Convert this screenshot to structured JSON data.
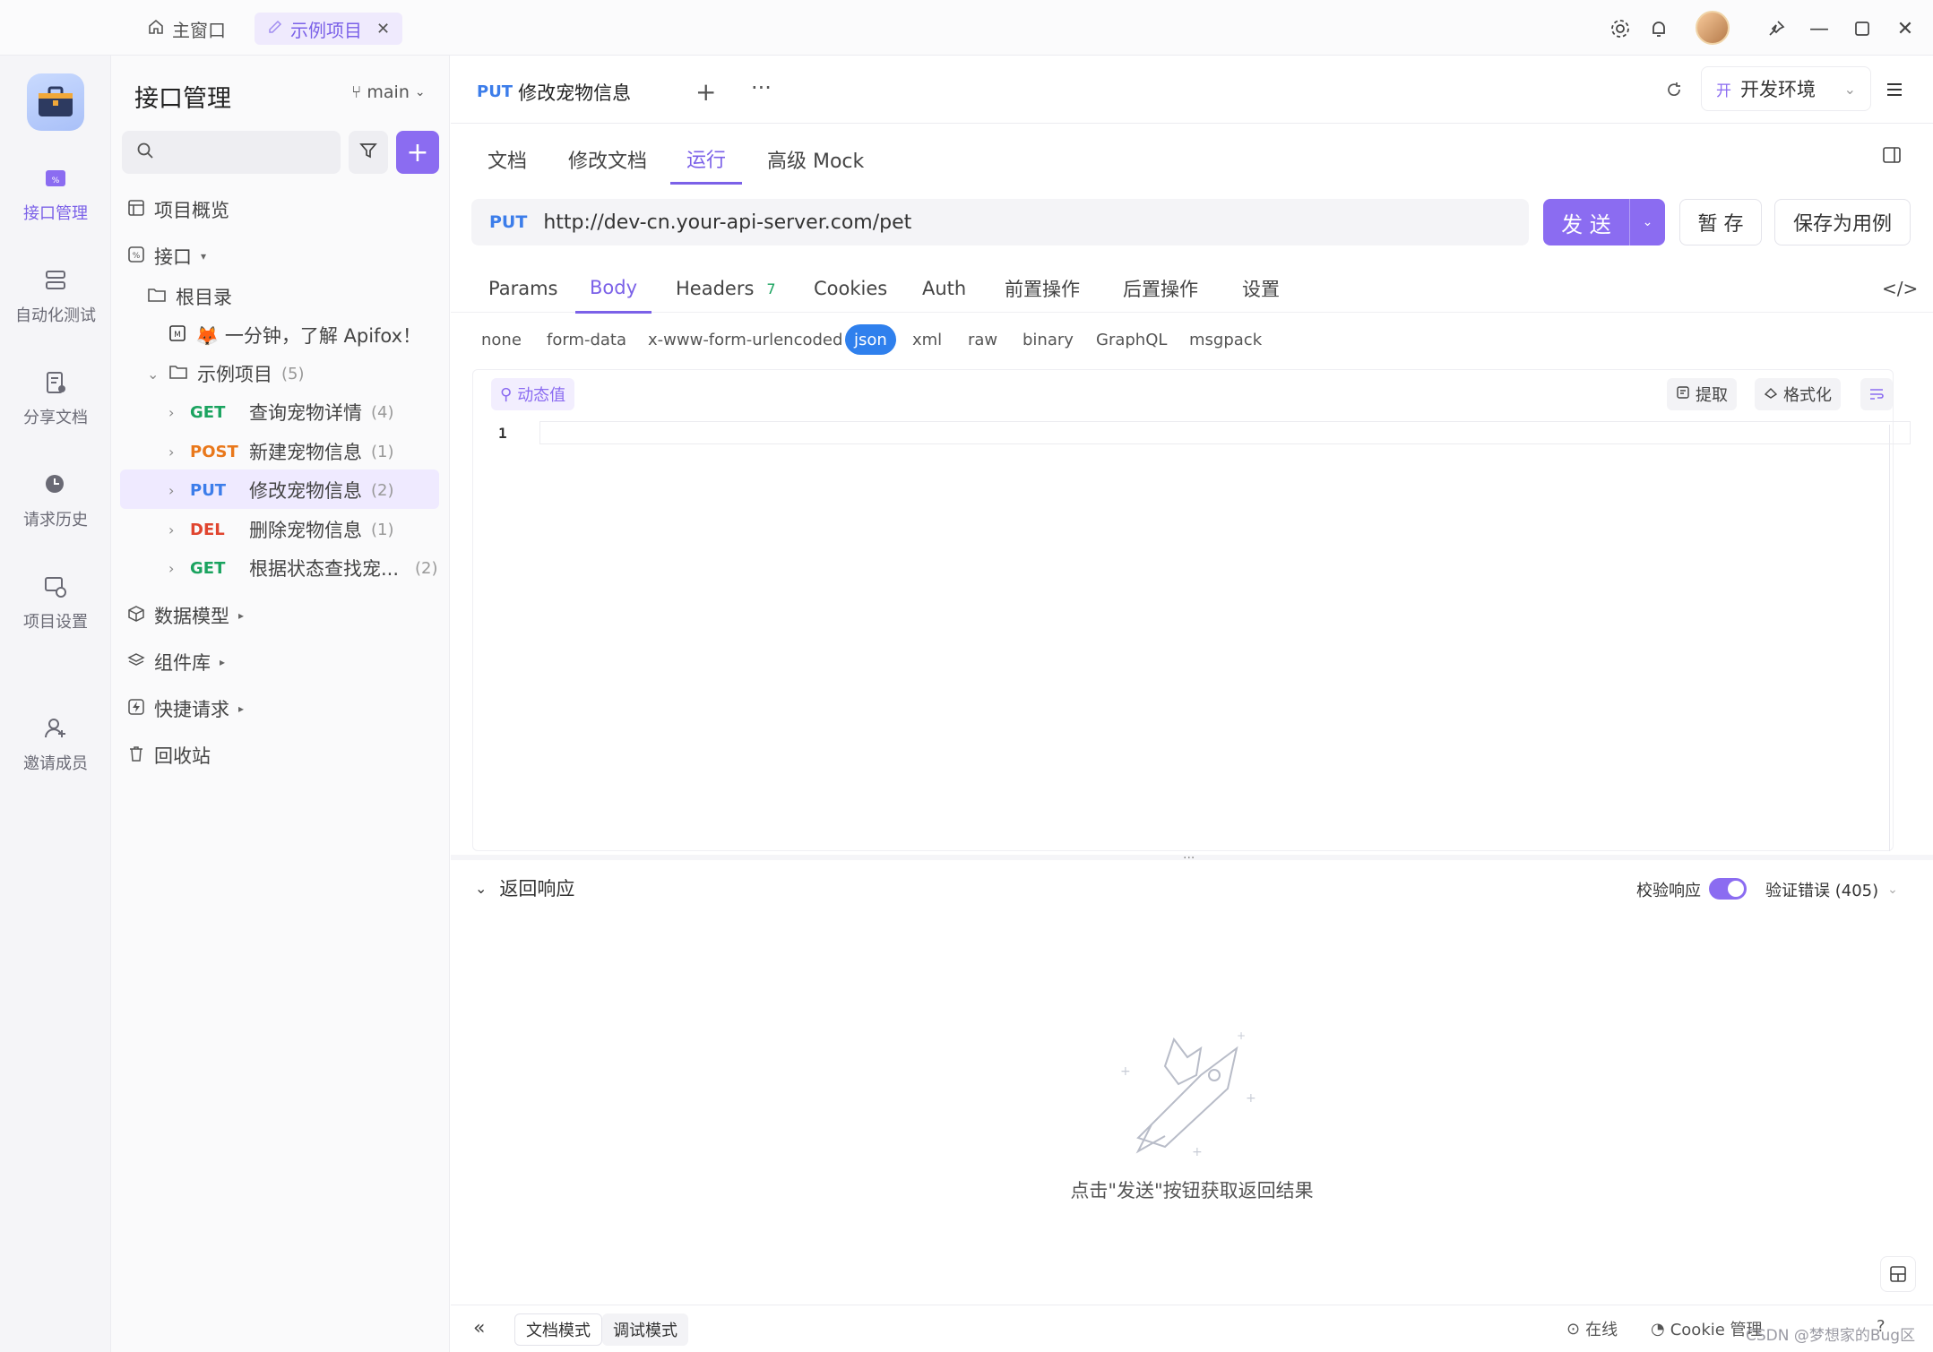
{
  "window": {
    "tabs": [
      {
        "label": "主窗口",
        "icon": "home-icon"
      },
      {
        "label": "示例项目",
        "icon": "edit-icon"
      }
    ]
  },
  "rail": {
    "items": [
      {
        "label": "接口管理",
        "icon": "api-icon",
        "active": true
      },
      {
        "label": "自动化测试",
        "icon": "automation-icon"
      },
      {
        "label": "分享文档",
        "icon": "share-doc-icon"
      },
      {
        "label": "请求历史",
        "icon": "history-icon"
      },
      {
        "label": "项目设置",
        "icon": "project-settings-icon"
      },
      {
        "label": "邀请成员",
        "icon": "invite-icon"
      }
    ]
  },
  "sidebar": {
    "title": "接口管理",
    "branch": "main",
    "tree": {
      "overview": "项目概览",
      "apis": "接口",
      "root": "根目录",
      "intro": "🦊 一分钟，了解 Apifox！",
      "folder": "示例项目",
      "folder_count": "(5)",
      "endpoints": [
        {
          "method": "GET",
          "name": "查询宠物详情",
          "count": "(4)"
        },
        {
          "method": "POST",
          "name": "新建宠物信息",
          "count": "(1)"
        },
        {
          "method": "PUT",
          "name": "修改宠物信息",
          "count": "(2)"
        },
        {
          "method": "DEL",
          "name": "删除宠物信息",
          "count": "(1)"
        },
        {
          "method": "GET",
          "name": "根据状态查找宠...",
          "count": "(2)"
        }
      ],
      "data_model": "数据模型",
      "components": "组件库",
      "quick_request": "快捷请求",
      "recycle": "回收站"
    }
  },
  "main": {
    "doc_tab": {
      "method": "PUT",
      "title": "修改宠物信息"
    },
    "env": {
      "badge": "开",
      "label": "开发环境"
    },
    "sub_tabs": [
      "文档",
      "修改文档",
      "运行",
      "高级 Mock"
    ],
    "url": {
      "method": "PUT",
      "value": "http://dev-cn.your-api-server.com/pet"
    },
    "buttons": {
      "send": "发 送",
      "save_temp": "暂 存",
      "save_case": "保存为用例"
    },
    "req_tabs": [
      {
        "label": "Params"
      },
      {
        "label": "Body",
        "active": true
      },
      {
        "label": "Headers",
        "badge": "7"
      },
      {
        "label": "Cookies"
      },
      {
        "label": "Auth"
      },
      {
        "label": "前置操作"
      },
      {
        "label": "后置操作"
      },
      {
        "label": "设置"
      }
    ],
    "body_types": [
      "none",
      "form-data",
      "x-www-form-urlencoded",
      "json",
      "xml",
      "raw",
      "binary",
      "GraphQL",
      "msgpack"
    ],
    "body_type_selected": "json",
    "editor": {
      "dynamic": "动态值",
      "extract": "提取",
      "format": "格式化",
      "line": "1"
    },
    "response": {
      "title": "返回响应",
      "validate": "校验响应",
      "validate_on": true,
      "error": "验证错误 (405)",
      "empty_text": "点击\"发送\"按钮获取返回结果"
    },
    "status": {
      "doc_mode": "文档模式",
      "debug_mode": "调试模式",
      "online": "在线",
      "cookie": "Cookie 管理",
      "watermark": "CSDN @梦想家的Bug区"
    }
  },
  "colors": {
    "accent": "#8b6cf1",
    "get": "#1aa35f",
    "post": "#e9781b",
    "put": "#3c7dea",
    "del": "#e0452f"
  }
}
